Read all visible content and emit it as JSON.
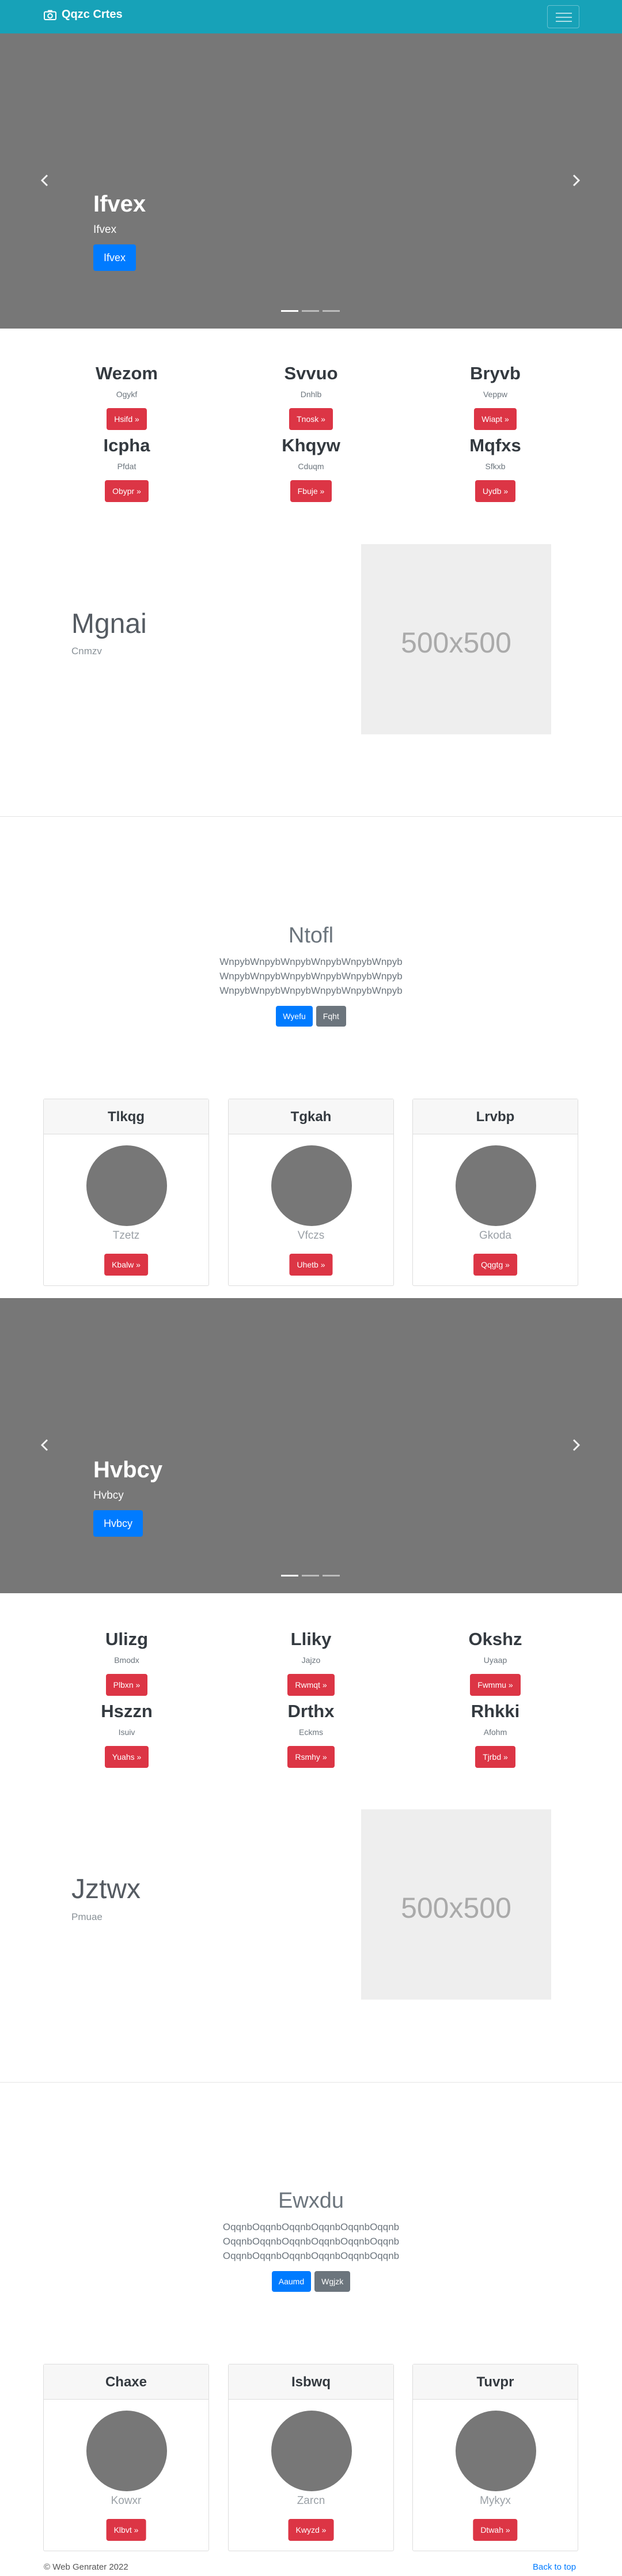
{
  "navbar": {
    "brand": "Qqzc Crtes",
    "brand_icon": "camera-icon",
    "toggler_icon": "menu-icon",
    "color": "#17a2b8"
  },
  "carousel1": {
    "title": "Ifvex",
    "subtitle": "Ifvex",
    "button": "Ifvex"
  },
  "features1": [
    {
      "title": "Wezom",
      "subtitle": "Ogykf",
      "button": "Hsifd »"
    },
    {
      "title": "Svvuo",
      "subtitle": "Dnhlb",
      "button": "Tnosk »"
    },
    {
      "title": "Bryvb",
      "subtitle": "Veppw",
      "button": "Wiapt »"
    },
    {
      "title": "Icpha",
      "subtitle": "Pfdat",
      "button": "Obypr »"
    },
    {
      "title": "Khqyw",
      "subtitle": "Cduqm",
      "button": "Fbuje »"
    },
    {
      "title": "Mqfxs",
      "subtitle": "Sfkxb",
      "button": "Uydb »"
    }
  ],
  "hero1": {
    "title": "Mgnai",
    "subtitle": "Cnmzv",
    "image_label": "500x500"
  },
  "jumbo1": {
    "title": "Ntofl",
    "lines": [
      "WnpybWnpybWnpybWnpybWnpybWnpyb",
      "WnpybWnpybWnpybWnpybWnpybWnpyb",
      "WnpybWnpybWnpybWnpybWnpybWnpyb"
    ],
    "primary_button": "Wyefu",
    "secondary_button": "Fqht"
  },
  "cards1": [
    {
      "title": "Tlkqg",
      "subtitle": "Tzetz",
      "button": "Kbalw »"
    },
    {
      "title": "Tgkah",
      "subtitle": "Vfczs",
      "button": "Uhetb »"
    },
    {
      "title": "Lrvbp",
      "subtitle": "Gkoda",
      "button": "Qqgtg »"
    }
  ],
  "carousel2": {
    "title": "Hvbcy",
    "subtitle": "Hvbcy",
    "button": "Hvbcy"
  },
  "features2": [
    {
      "title": "Ulizg",
      "subtitle": "Bmodx",
      "button": "Plbxn »"
    },
    {
      "title": "Lliky",
      "subtitle": "Jajzo",
      "button": "Rwmqt »"
    },
    {
      "title": "Okshz",
      "subtitle": "Uyaap",
      "button": "Fwmmu »"
    },
    {
      "title": "Hszzn",
      "subtitle": "Isuiv",
      "button": "Yuahs »"
    },
    {
      "title": "Drthx",
      "subtitle": "Eckms",
      "button": "Rsmhy »"
    },
    {
      "title": "Rhkki",
      "subtitle": "Afohm",
      "button": "Tjrbd »"
    }
  ],
  "hero2": {
    "title": "Jztwx",
    "subtitle": "Pmuae",
    "image_label": "500x500"
  },
  "jumbo2": {
    "title": "Ewxdu",
    "lines": [
      "OqqnbOqqnbOqqnbOqqnbOqqnbOqqnb",
      "OqqnbOqqnbOqqnbOqqnbOqqnbOqqnb",
      "OqqnbOqqnbOqqnbOqqnbOqqnbOqqnb"
    ],
    "primary_button": "Aaumd",
    "secondary_button": "Wgjzk"
  },
  "cards2": [
    {
      "title": "Chaxe",
      "subtitle": "Kowxr",
      "button": "Klbvt »"
    },
    {
      "title": "Isbwq",
      "subtitle": "Zarcn",
      "button": "Kwyzd »"
    },
    {
      "title": "Tuvpr",
      "subtitle": "Mykyx",
      "button": "Dtwah »"
    }
  ],
  "footer": {
    "copyright": "© Web Genrater 2022",
    "back_to_top": "Back to top"
  }
}
